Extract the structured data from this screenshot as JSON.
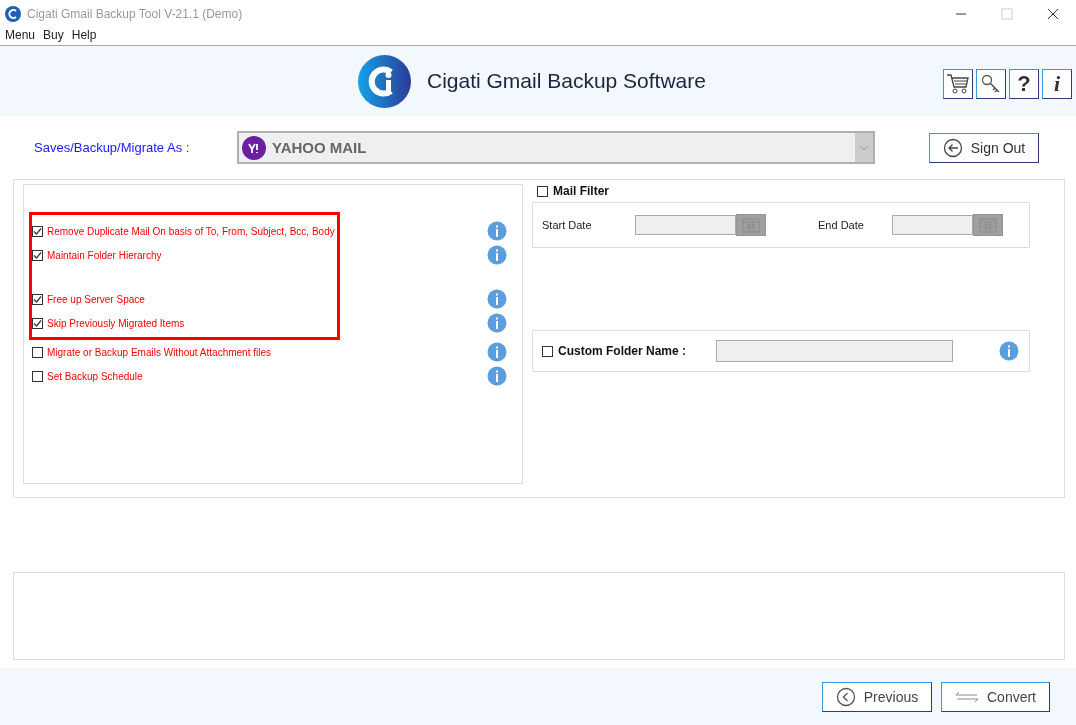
{
  "window": {
    "title": "Cigati Gmail Backup Tool V-21.1 (Demo)"
  },
  "menu": [
    "Menu",
    "Buy",
    "Help"
  ],
  "header": {
    "title": "Cigati Gmail Backup Software",
    "tool_buttons": [
      {
        "kind": "cart"
      },
      {
        "kind": "key"
      },
      {
        "kind": "text",
        "label": "?"
      },
      {
        "kind": "text",
        "label": "i"
      }
    ]
  },
  "save_as": {
    "label": "Saves/Backup/Migrate As :",
    "value": "YAHOO MAIL"
  },
  "sign_out": "Sign Out",
  "options": [
    {
      "label": "Remove Duplicate Mail On basis of To, From, Subject, Bcc, Body",
      "checked": true,
      "highlighted": true
    },
    {
      "label": "Maintain Folder Hierarchy",
      "checked": true,
      "highlighted": true
    },
    {
      "label": "Free up Server Space",
      "checked": true,
      "highlighted": true
    },
    {
      "label": "Skip Previously Migrated Items",
      "checked": true,
      "highlighted": true
    },
    {
      "label": "Migrate or Backup Emails Without Attachment files",
      "checked": false,
      "highlighted": false
    },
    {
      "label": "Set Backup Schedule",
      "checked": false,
      "highlighted": false
    }
  ],
  "mail_filter": {
    "label": "Mail Filter",
    "checked": false,
    "start_label": "Start Date",
    "end_label": "End Date"
  },
  "custom_folder": {
    "label": "Custom Folder Name :",
    "checked": false
  },
  "footer": {
    "previous": "Previous",
    "convert": "Convert"
  }
}
